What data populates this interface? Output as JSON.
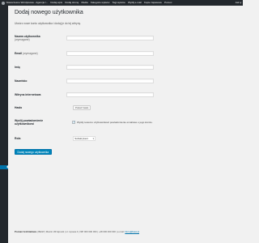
{
  "admin_bar": {
    "items": [
      "Nowoczesne Wordpressa - Agencja I...",
      "Dodaj wpis",
      "Dodaj stronę",
      "Media",
      "Kategorie wpisów",
      "Tagi wpisów",
      "Wyślij e-mail",
      "Kopie zapasowe",
      "Pomoc"
    ],
    "account": "Jak ty"
  },
  "page": {
    "title": "Dodaj nowego użytkownika",
    "intro": "Utwórz nowe konto użytkownika i dodaj je do tej witryny."
  },
  "form": {
    "username": {
      "label": "Nazwa użytkownika",
      "sublabel": "(wymagane)",
      "value": ""
    },
    "email": {
      "label": "Email",
      "sublabel": "(wymagane)",
      "value": ""
    },
    "first_name": {
      "label": "Imię",
      "value": ""
    },
    "last_name": {
      "label": "Nazwisko",
      "value": ""
    },
    "website": {
      "label": "Witryna internetowa",
      "value": ""
    },
    "password": {
      "label": "Hasło",
      "button": "Pokaż hasło"
    },
    "notify": {
      "label": "Wyślij powiadomienie użytkownikowi",
      "checked": true,
      "mark": "✓",
      "text": "Wyślij nowemu użytkownikowi powiadomienie emailowe o jego koncie."
    },
    "role": {
      "label": "Rola",
      "selected": "Subskrybent",
      "chevron": "▾"
    },
    "submit": "Dodaj nowego użytkownika"
  },
  "footer": {
    "name": "Poznań Architektura",
    "details": " | BEIW | Marcin Wrzątrosik | ul. Lipowa 4 | NIP 000 000 000 | +48 000 000 000 | e-mail:",
    "email": "biuro@beiw.pl"
  },
  "colors": {
    "admin_bar_bg": "#23282d",
    "sidebar_bg": "#23282d",
    "sidebar_active": "#0073aa",
    "primary_button": "#0085ba",
    "page_bg": "#f1f1f1"
  }
}
